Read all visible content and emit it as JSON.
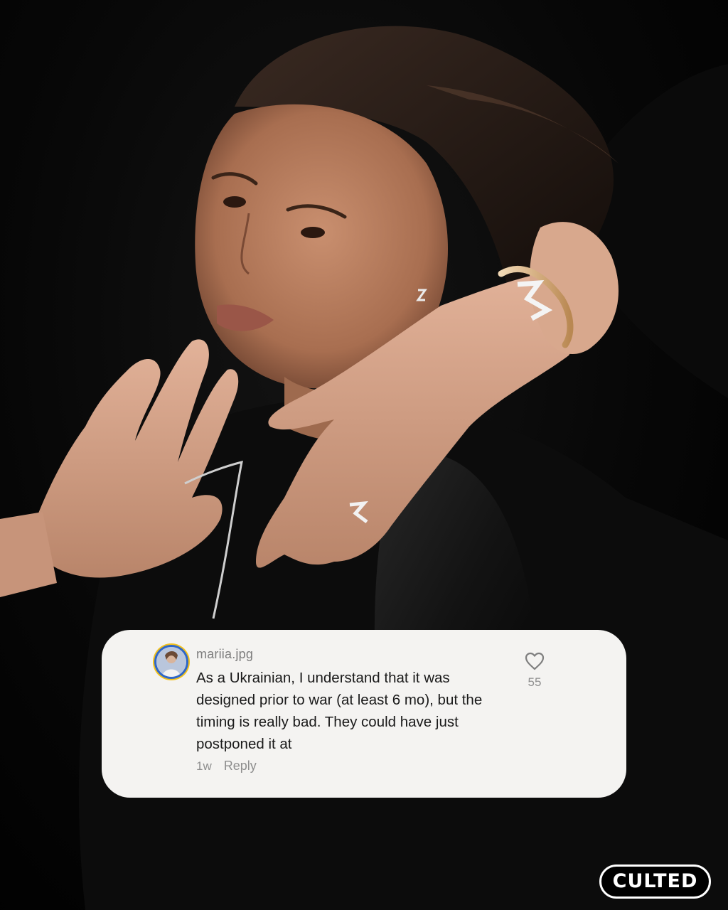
{
  "comment": {
    "username": "mariia.jpg",
    "text": "As a Ukrainian, I understand that it was designed prior to war (at least 6 mo), but the timing is really bad. They could have just postponed it at",
    "time_ago": "1w",
    "reply_label": "Reply",
    "like_count": "55"
  },
  "brand": {
    "logo_text": "CULTED"
  },
  "icons": {
    "like": "heart-outline-icon"
  },
  "colors": {
    "card_background": "#f4f3f1",
    "avatar_ring_outer": "#f4c21c",
    "avatar_ring_inner": "#2f67c8",
    "muted_text": "#8e8e8e",
    "body_text": "#1a1a1a"
  }
}
